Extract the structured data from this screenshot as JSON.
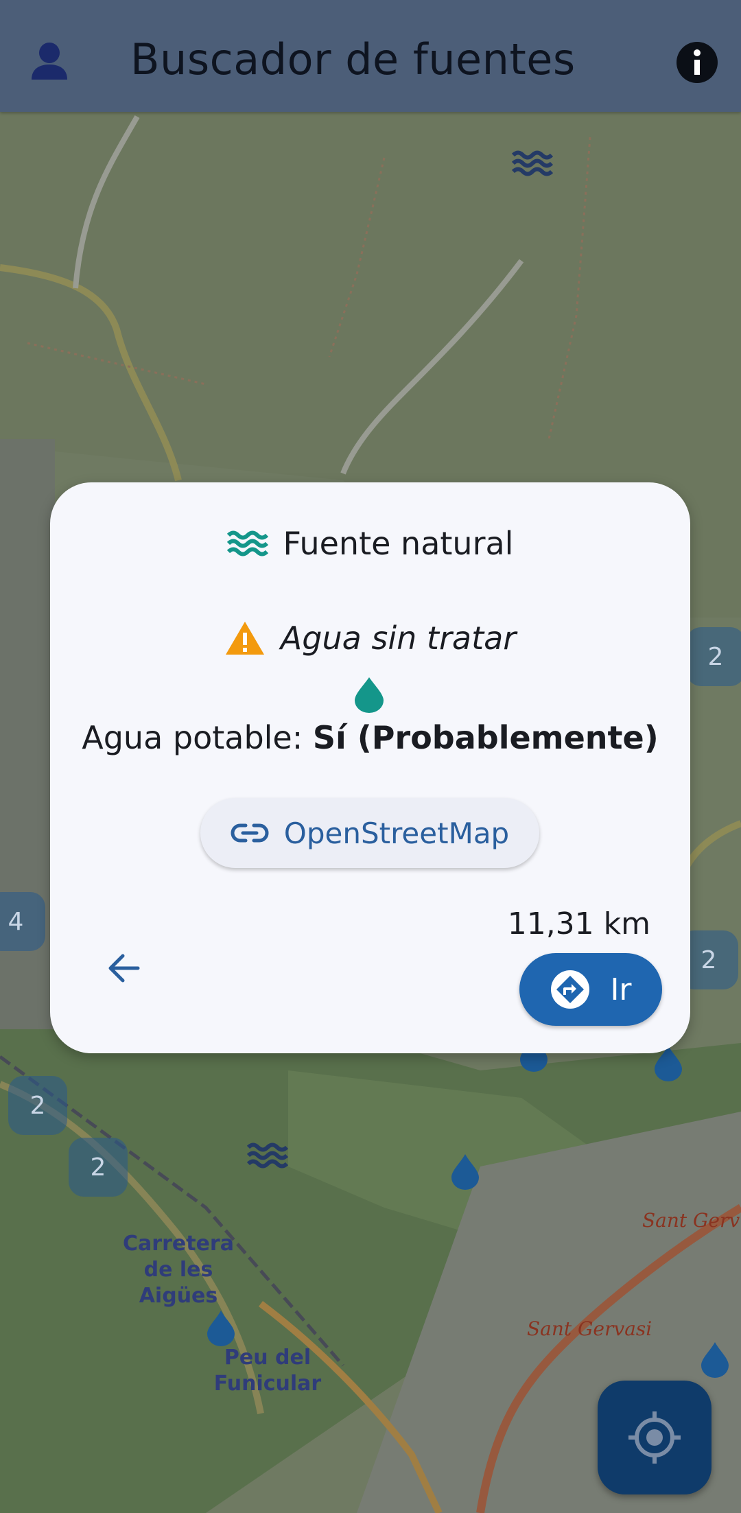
{
  "app_bar": {
    "title": "Buscador de fuentes",
    "profile_icon": "person-icon",
    "info_icon": "info-icon"
  },
  "map": {
    "clusters": [
      "2",
      "4",
      "2",
      "2",
      "2"
    ],
    "labels": {
      "carretera": "Carretera de les Aigües",
      "peu": "Peu del Funicular",
      "sant_gervasi_1": "Sant Gervasi",
      "sant_gervasi_2": "Sant Gerv"
    }
  },
  "dialog": {
    "type_icon": "water-waves-icon",
    "type_label": "Fuente natural",
    "warning_icon": "warning-triangle-icon",
    "warning_label": "Agua sin tratar",
    "drop_icon": "water-drop-icon",
    "potable_prefix": "Agua potable: ",
    "potable_value": "Sí (Probablemente)",
    "osm_button_label": "OpenStreetMap",
    "osm_icon": "link-icon",
    "distance": "11,31 km",
    "back_icon": "arrow-back-icon",
    "go_button_label": "Ir",
    "go_icon": "directions-icon"
  },
  "fab": {
    "icon": "my-location-icon"
  },
  "colors": {
    "app_bar": "#4c5e78",
    "dialog_bg": "#f6f7fc",
    "primary": "#1f66b0",
    "teal": "#14968a",
    "warning": "#f39a0e",
    "fab": "#0f3b6a"
  }
}
